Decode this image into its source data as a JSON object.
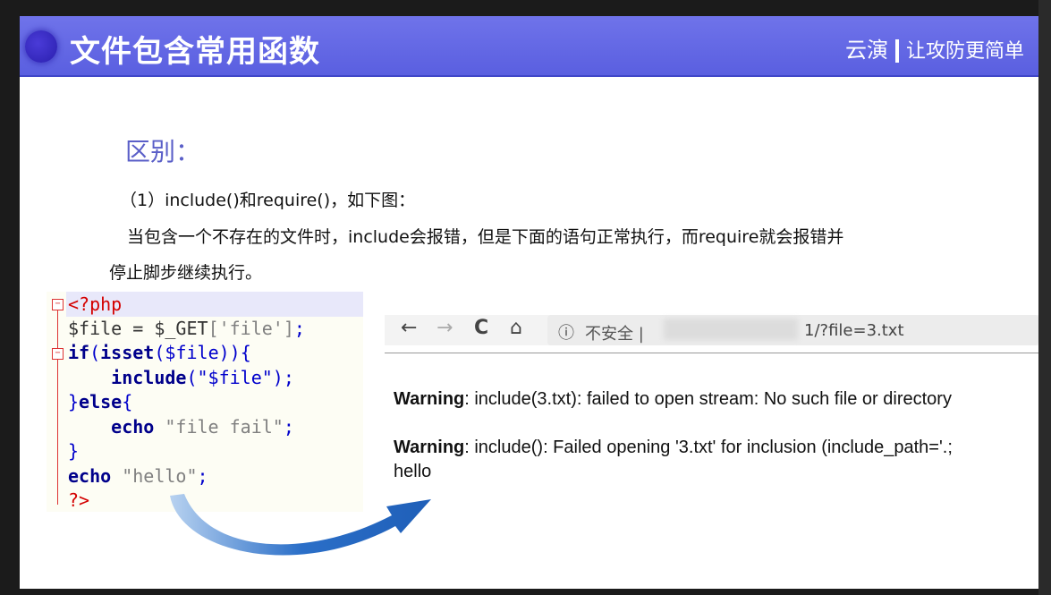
{
  "header": {
    "title": "文件包含常用函数",
    "brand": "云演",
    "slogan": "让攻防更简单"
  },
  "section_title": "区别：",
  "paragraphs": {
    "p1": "（1）include()和require()，如下图：",
    "p2": "当包含一个不存在的文件时，include会报错，但是下面的语句正常执行，而require就会报错并",
    "p3": "停止脚步继续执行。"
  },
  "code": {
    "open_tag": "<?php",
    "line1_var": "$file",
    "line1_op": " = ",
    "line1_get": "$_GET",
    "line1_str": "['file']",
    "line1_end": ";",
    "line2_if": "if",
    "line2_rest": "(",
    "line2_isset": "isset",
    "line2_arg": "($file)){",
    "line3_include": "include",
    "line3_arg": "(\"$file\");",
    "line4_close": "}",
    "line4_else": "else",
    "line4_brace": "{",
    "line5_echo": "echo",
    "line5_str": " \"file fail\"",
    "line5_end": ";",
    "line6_close": "}",
    "line7_echo": "echo",
    "line7_str": " \"hello\"",
    "line7_end": ";",
    "close_tag": "?>"
  },
  "browser": {
    "back_icon": "←",
    "forward_icon": "→",
    "reload_icon": "C",
    "home_icon": "⌂",
    "info_icon": "ⓘ",
    "insecure_label": "不安全 |",
    "url_suffix": "1/?file=3.txt"
  },
  "output": {
    "warning_label_1": "Warning",
    "warning_text_1": ": include(3.txt): failed to open stream: No such file or directory",
    "warning_label_2": "Warning",
    "warning_text_2": ": include(): Failed opening '3.txt' for inclusion (include_path='.;",
    "hello": "hello"
  },
  "colors": {
    "header_bg": "#5a5fe0",
    "section_title": "#5a5fc8",
    "arrow": "#2b6fc8"
  }
}
